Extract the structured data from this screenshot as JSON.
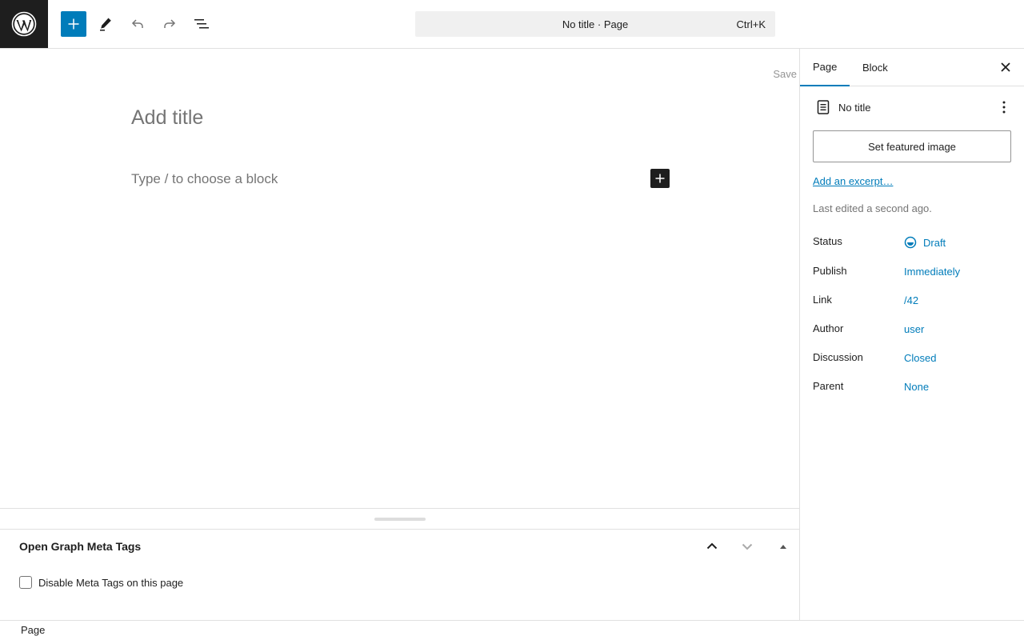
{
  "toolbar": {
    "logo_icon": "wordpress-icon",
    "add_icon": "plus-icon",
    "edit_icon": "pencil-icon",
    "undo_icon": "undo-icon",
    "redo_icon": "redo-icon",
    "list_icon": "list-view-icon",
    "command": {
      "title": "No title · Page",
      "shortcut": "Ctrl+K"
    }
  },
  "editor": {
    "save_label": "Save",
    "title_placeholder": "Add title",
    "block_placeholder": "Type / to choose a block"
  },
  "meta_box": {
    "title": "Open Graph Meta Tags",
    "checkbox_label": "Disable Meta Tags on this page",
    "checkbox_checked": false
  },
  "footer": {
    "breadcrumb": "Page"
  },
  "sidebar": {
    "tabs": [
      {
        "label": "Page",
        "active": true
      },
      {
        "label": "Block",
        "active": false
      }
    ],
    "doc_title": "No title",
    "featured_image_label": "Set featured image",
    "excerpt_link": "Add an excerpt…",
    "last_edited": "Last edited a second ago.",
    "properties": [
      {
        "label": "Status",
        "value": "Draft"
      },
      {
        "label": "Publish",
        "value": "Immediately"
      },
      {
        "label": "Link",
        "value": "/42"
      },
      {
        "label": "Author",
        "value": "user"
      },
      {
        "label": "Discussion",
        "value": "Closed"
      },
      {
        "label": "Parent",
        "value": "None"
      }
    ]
  },
  "colors": {
    "accent": "#007cba",
    "dark": "#1e1e1e",
    "muted": "#757575"
  }
}
